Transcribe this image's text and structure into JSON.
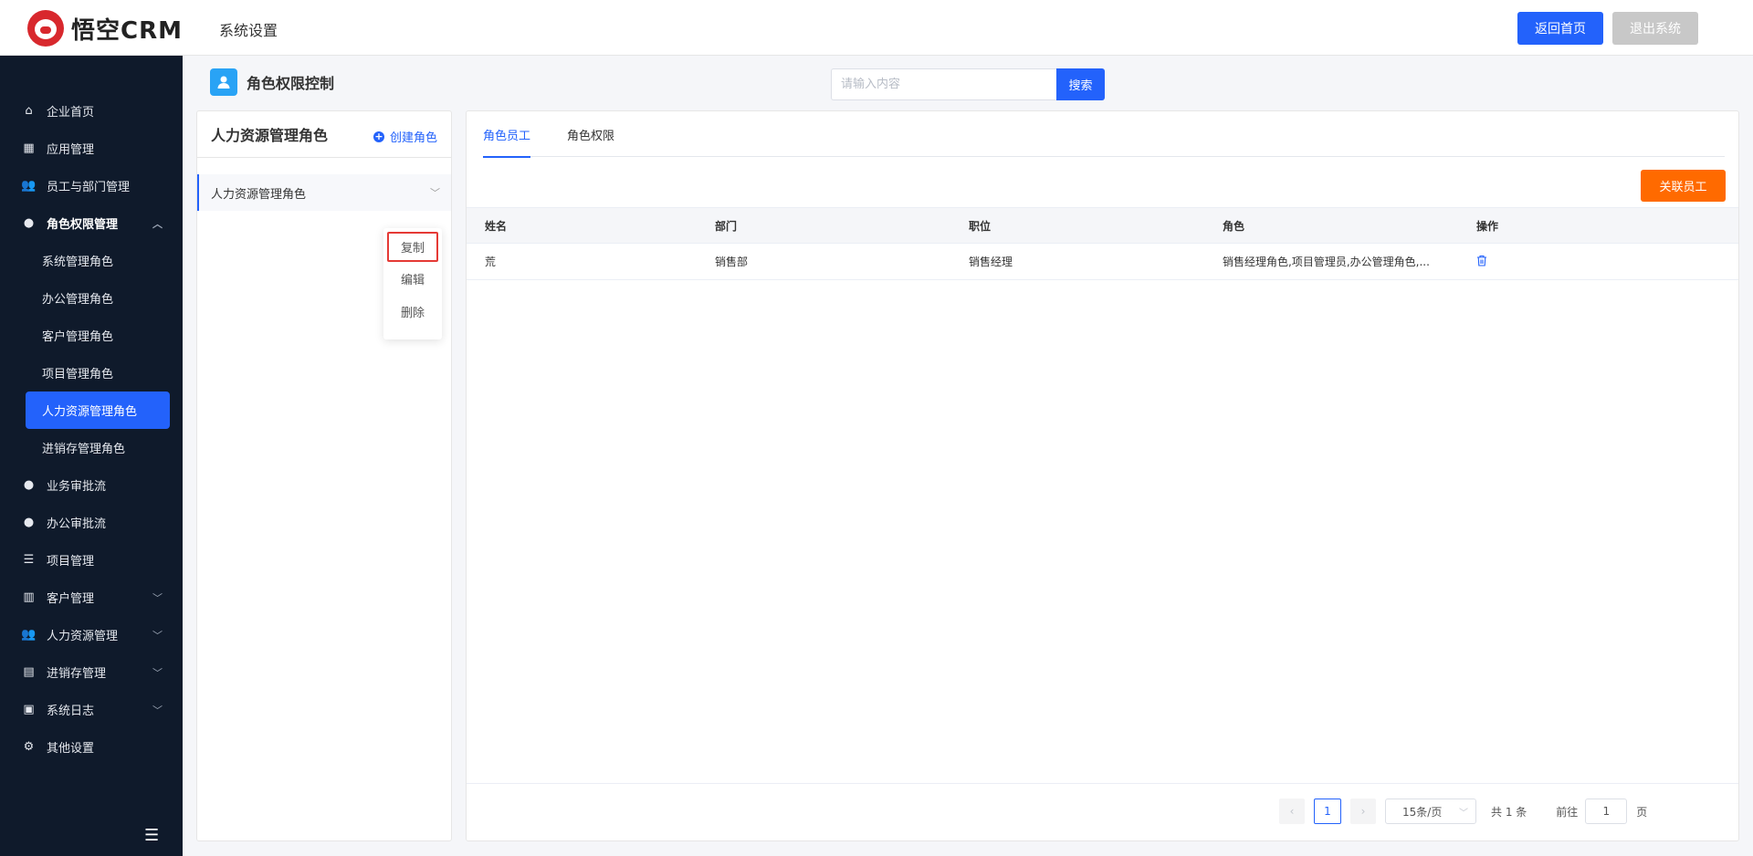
{
  "header": {
    "logo_text": "悟空CRM",
    "title": "系统设置",
    "home_button": "返回首页",
    "exit_button": "退出系统"
  },
  "sidebar": {
    "items": [
      {
        "label": "企业首页",
        "icon": "home-icon"
      },
      {
        "label": "应用管理",
        "icon": "grid-icon"
      },
      {
        "label": "员工与部门管理",
        "icon": "users-icon"
      },
      {
        "label": "角色权限管理",
        "icon": "user-icon"
      }
    ],
    "sub_items": [
      {
        "label": "系统管理角色"
      },
      {
        "label": "办公管理角色"
      },
      {
        "label": "客户管理角色"
      },
      {
        "label": "项目管理角色"
      },
      {
        "label": "人力资源管理角色"
      },
      {
        "label": "进销存管理角色"
      }
    ],
    "bottom_items": [
      {
        "label": "业务审批流",
        "icon": "user-icon"
      },
      {
        "label": "办公审批流",
        "icon": "user-icon"
      },
      {
        "label": "项目管理",
        "icon": "list-icon"
      },
      {
        "label": "客户管理",
        "icon": "building-icon"
      },
      {
        "label": "人力资源管理",
        "icon": "users-icon"
      },
      {
        "label": "进销存管理",
        "icon": "truck-icon"
      },
      {
        "label": "系统日志",
        "icon": "clipboard-icon"
      },
      {
        "label": "其他设置",
        "icon": "gear-icon"
      }
    ]
  },
  "page": {
    "title": "角色权限控制",
    "search_placeholder": "请输入内容",
    "search_button": "搜索"
  },
  "role_panel": {
    "title": "人力资源管理角色",
    "create_label": "创建角色",
    "role_name": "人力资源管理角色",
    "menu": [
      "复制",
      "编辑",
      "删除"
    ]
  },
  "content": {
    "tabs": [
      "角色员工",
      "角色权限"
    ],
    "assoc_button": "关联员工",
    "columns": [
      "姓名",
      "部门",
      "职位",
      "角色",
      "操作"
    ],
    "rows": [
      {
        "name": "荒",
        "dept": "销售部",
        "position": "销售经理",
        "roles": "销售经理角色,项目管理员,办公管理角色,..."
      }
    ]
  },
  "pagination": {
    "current_page": "1",
    "page_size": "15条/页",
    "total": "共 1 条",
    "goto_label": "前往",
    "goto_value": "1",
    "page_suffix": "页"
  },
  "colors": {
    "primary": "#2362fb",
    "sidebar_bg": "#0f1a2b",
    "orange": "#ff6a00",
    "highlight_border": "#e53935"
  }
}
